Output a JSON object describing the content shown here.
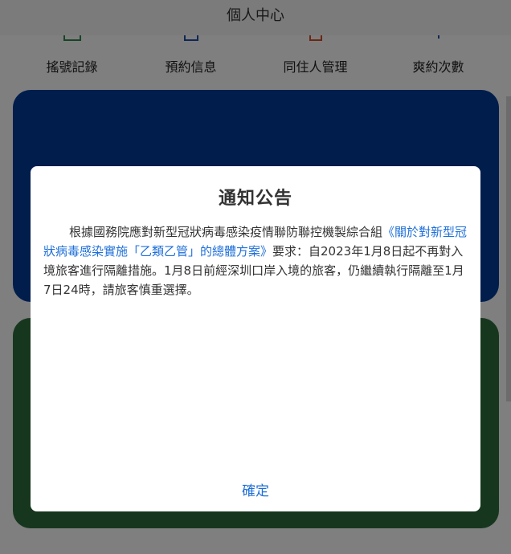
{
  "header": {
    "title": "個人中心"
  },
  "nav": {
    "items": [
      {
        "label": "搖號記錄",
        "icon": "lottery-record-icon"
      },
      {
        "label": "預約信息",
        "icon": "calendar-icon"
      },
      {
        "label": "同住人管理",
        "icon": "cohabitant-icon"
      },
      {
        "label": "爽約次數",
        "icon": "missed-appointment-icon"
      }
    ]
  },
  "colors": {
    "card_blue": "#003a99",
    "card_green": "#2f6d3d",
    "link": "#1e6fd9"
  },
  "modal": {
    "title": "通知公告",
    "body_part1": "根據國務院應對新型冠狀病毒感染疫情聯防聯控機製綜合組",
    "body_link": "《關於對新型冠狀病毒感染實施「乙類乙管」的總體方案》",
    "body_part2": "要求：自2023年1月8日起不再對入境旅客進行隔離措施。1月8日前經深圳口岸入境的旅客，仍繼續執行隔離至1月7日24時，請旅客慎重選擇。",
    "confirm_label": "確定"
  }
}
